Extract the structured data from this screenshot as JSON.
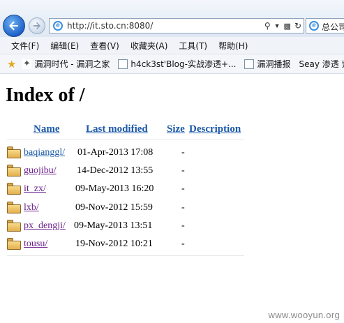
{
  "browser": {
    "url": "http://it.sto.cn:8080/",
    "tab_title": "总公司",
    "menu": [
      "文件(F)",
      "编辑(E)",
      "查看(V)",
      "收藏夹(A)",
      "工具(T)",
      "帮助(H)"
    ],
    "favorites": [
      "漏洞时代 - 漏洞之家",
      "h4ck3st'Blog-实战渗透+...",
      "漏洞播报",
      "Seay 渗透 紫"
    ]
  },
  "page": {
    "title": "Index of /",
    "columns": {
      "name": "Name",
      "last_modified": "Last modified",
      "size": "Size",
      "description": "Description"
    },
    "rows": [
      {
        "name": "baqianggl/",
        "modified": "01-Apr-2013 17:08",
        "size": "-"
      },
      {
        "name": "guojibu/",
        "modified": "14-Dec-2012 13:55",
        "size": "-"
      },
      {
        "name": "it_zx/",
        "modified": "09-May-2013 16:20",
        "size": "-"
      },
      {
        "name": "lxb/",
        "modified": "09-Nov-2012 15:59",
        "size": "-"
      },
      {
        "name": "px_dengji/",
        "modified": "09-May-2013 13:51",
        "size": "-"
      },
      {
        "name": "tousu/",
        "modified": "19-Nov-2012 10:21",
        "size": "-"
      }
    ]
  },
  "watermark": "www.wooyun.org"
}
